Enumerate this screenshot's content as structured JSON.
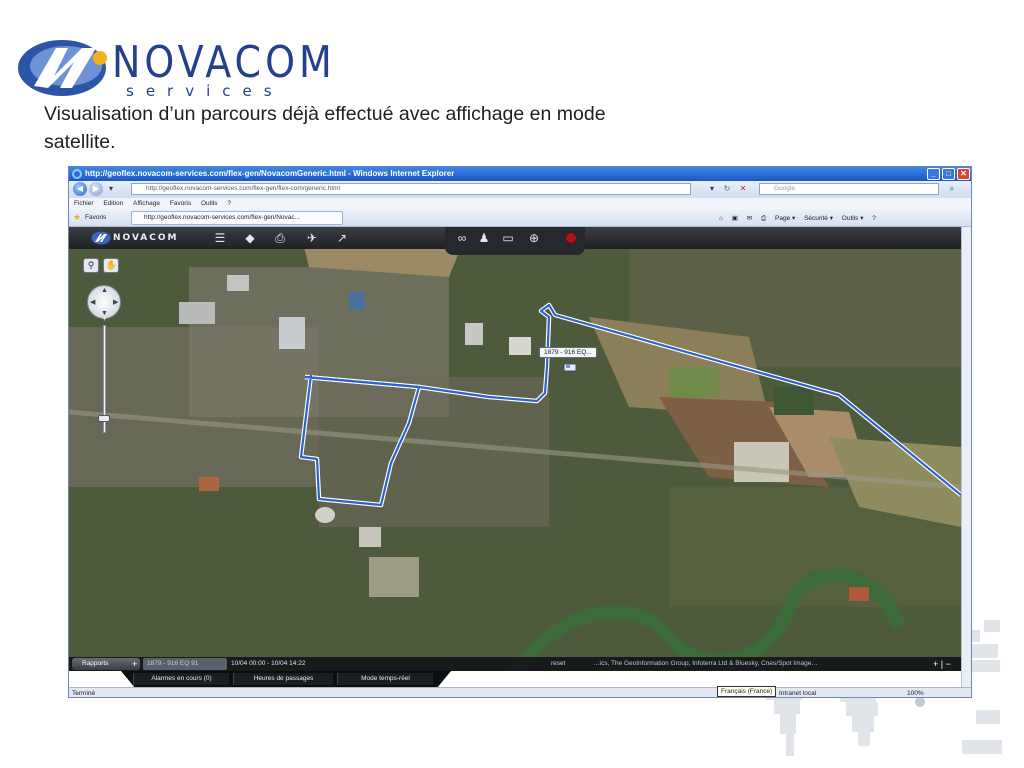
{
  "slide": {
    "logo": {
      "word": "NOVACOM",
      "sub": "services"
    },
    "caption": "Visualisation d’un parcours déjà effectué avec affichage en mode satellite.",
    "colors": {
      "logo_blue": "#25408f",
      "route": "#2d63c8",
      "text": "#1f1f1f"
    }
  },
  "browser": {
    "title": "http://geoflex.novacom-services.com/flex-gen/NovacomGeneric.html - Windows Internet Explorer",
    "address": "http://geoflex.novacom-services.com/flex-gen/flex-com/generic.html",
    "search_placeholder": "Google",
    "menu": [
      "Fichier",
      "Edition",
      "Affichage",
      "Favoris",
      "Outils",
      "?"
    ],
    "favorites_label": "Favoris",
    "tab_title": "http://geoflex.novacom-services.com/flex-gen/Novac...",
    "commands": [
      "Page ▾",
      "Sécurité ▾",
      "Outils ▾"
    ],
    "status": {
      "left": "Terminé",
      "language_tooltip": "Français (France)",
      "zone": "Intranet local",
      "zoom": "100%"
    }
  },
  "app": {
    "logo_text": "NOVACOM",
    "vehicle_label": "1879 - 916 EQ...",
    "bottom": {
      "rapports_label": "Rapports",
      "vehicle_chip": "1879 - 916 EQ 91",
      "period": "10/04 00:00 - 10/04 14:22",
      "reset": "reset",
      "copyright": "…ics, The GeoInformation Group, Infoterra Ltd & Bluesky, Cnes/Spot Image…"
    },
    "tabs": [
      "Alarmes en cours (0)",
      "Heures de passages",
      "Mode temps-réel"
    ],
    "icons": [
      "list-icon",
      "layers-icon",
      "printer-icon",
      "plane-icon",
      "route-icon",
      "link-icon",
      "user-icon",
      "vehicles-icon",
      "globe-icon",
      "stop-icon"
    ]
  }
}
